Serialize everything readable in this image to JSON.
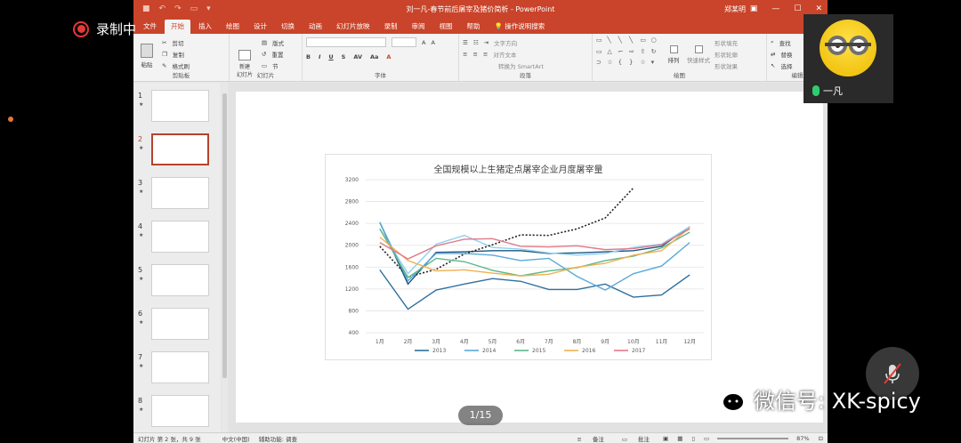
{
  "recording": {
    "label": "录制中"
  },
  "window": {
    "title": "刘一凡-春节前后屠宰及猪价简析  -  PowerPoint",
    "user": "郑某明",
    "tabs": [
      "文件",
      "开始",
      "插入",
      "绘图",
      "设计",
      "切换",
      "动画",
      "幻灯片放映",
      "录制",
      "审阅",
      "视图",
      "帮助"
    ],
    "active_tab": "开始",
    "tell_me": "操作说明搜索"
  },
  "ribbon": {
    "clipboard": {
      "paste": "粘贴",
      "cut": "剪切",
      "copy": "复制",
      "format_painter": "格式刷",
      "label": "剪贴板"
    },
    "slides": {
      "new_slide": "新建\n幻灯片",
      "layout": "版式",
      "reset": "重置",
      "section": "节",
      "label": "幻灯片"
    },
    "font": {
      "label": "字体"
    },
    "paragraph": {
      "text_direction": "文字方向",
      "align_text": "对齐文本",
      "smartart": "转换为 SmartArt",
      "label": "段落"
    },
    "drawing": {
      "arrange": "排列",
      "quick_styles": "快速样式",
      "shape_fill": "形状填充",
      "shape_outline": "形状轮廓",
      "shape_effects": "形状效果",
      "label": "绘图"
    },
    "editing": {
      "find": "查找",
      "replace": "替换",
      "select": "选择",
      "label": "编辑"
    }
  },
  "thumbnails": [
    {
      "num": "1"
    },
    {
      "num": "2",
      "active": true
    },
    {
      "num": "3"
    },
    {
      "num": "4"
    },
    {
      "num": "5"
    },
    {
      "num": "6"
    },
    {
      "num": "7"
    },
    {
      "num": "8"
    }
  ],
  "pager": "1/15",
  "statusbar": {
    "slide_info": "幻灯片 第 2 张，共 9 张",
    "language": "中文(中国)",
    "accessibility": "辅助功能: 调查",
    "notes": "备注",
    "comments": "批注",
    "zoom": "87%"
  },
  "video": {
    "name": "一凡"
  },
  "watermark": {
    "text": "微信号: XK-spicy"
  },
  "chart_data": {
    "type": "line",
    "title": "全国规模以上生猪定点屠宰企业月度屠宰量",
    "categories": [
      "1月",
      "2月",
      "3月",
      "4月",
      "5月",
      "6月",
      "7月",
      "8月",
      "9月",
      "10月",
      "11月",
      "12月"
    ],
    "ylim": [
      400,
      3200
    ],
    "yticks": [
      400,
      800,
      1200,
      1600,
      2000,
      2400,
      2800,
      3200
    ],
    "grid": true,
    "legend_position": "bottom",
    "series": [
      {
        "name": "2013",
        "color": "#2e6f9e",
        "values": [
          1550,
          830,
          1180,
          1290,
          1390,
          1340,
          1190,
          1190,
          1290,
          1050,
          1090,
          1460
        ]
      },
      {
        "name": "2014",
        "color": "#5aa9d6",
        "values": [
          2420,
          1350,
          1850,
          1850,
          1820,
          1720,
          1760,
          1430,
          1180,
          1480,
          1620,
          2050
        ]
      },
      {
        "name": "2015",
        "color": "#5ab88a",
        "values": [
          2300,
          1410,
          1760,
          1700,
          1540,
          1440,
          1530,
          1590,
          1720,
          1800,
          1950,
          2240
        ]
      },
      {
        "name": "2016",
        "color": "#f0b050",
        "values": [
          2150,
          1720,
          1530,
          1550,
          1490,
          1440,
          1470,
          1600,
          1670,
          1820,
          1900,
          2320
        ]
      },
      {
        "name": "2017",
        "color": "#e07a8a",
        "values": [
          2050,
          1750,
          1990,
          2110,
          2120,
          1980,
          1970,
          1990,
          1920,
          1940,
          2010,
          2300
        ]
      }
    ],
    "extra_unlabeled_series": [
      {
        "color": "#1f5580",
        "values": [
          2420,
          1290,
          1870,
          1880,
          1900,
          1900,
          1850,
          1860,
          1880,
          1900,
          1980,
          2340
        ]
      },
      {
        "color": "#8fd0f0",
        "values": [
          2300,
          1480,
          2020,
          2180,
          1960,
          1930,
          1860,
          1820,
          1850,
          1960,
          2020,
          2340
        ]
      },
      {
        "color": "#222222",
        "dashed": true,
        "values": [
          1980,
          1420,
          1560,
          1840,
          2010,
          2190,
          2180,
          2300,
          2500,
          3050
        ]
      }
    ]
  }
}
